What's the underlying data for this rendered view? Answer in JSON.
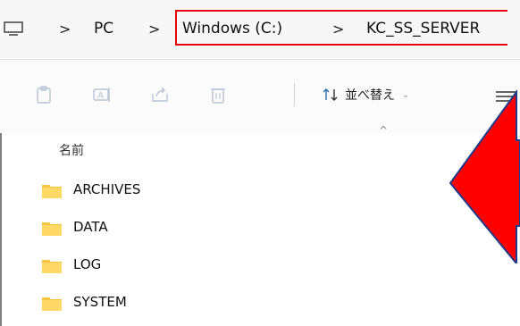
{
  "breadcrumb": {
    "items": [
      "PC",
      "Windows (C:)",
      "KC_SS_SERVER"
    ],
    "separator": ">"
  },
  "toolbar": {
    "icons": [
      "paste-icon",
      "rename-icon",
      "share-icon",
      "delete-icon"
    ],
    "sort_label": "並べ替え",
    "sort_chevron": "⌄"
  },
  "column_header": {
    "name_label": "名前",
    "sort_indicator": "^"
  },
  "folders": [
    "ARCHIVES",
    "DATA",
    "LOG",
    "SYSTEM"
  ],
  "colors": {
    "highlight": "#e60012",
    "arrow_fill": "#ff0000",
    "arrow_stroke": "#1f3a8a",
    "folder": "#f5c542"
  }
}
